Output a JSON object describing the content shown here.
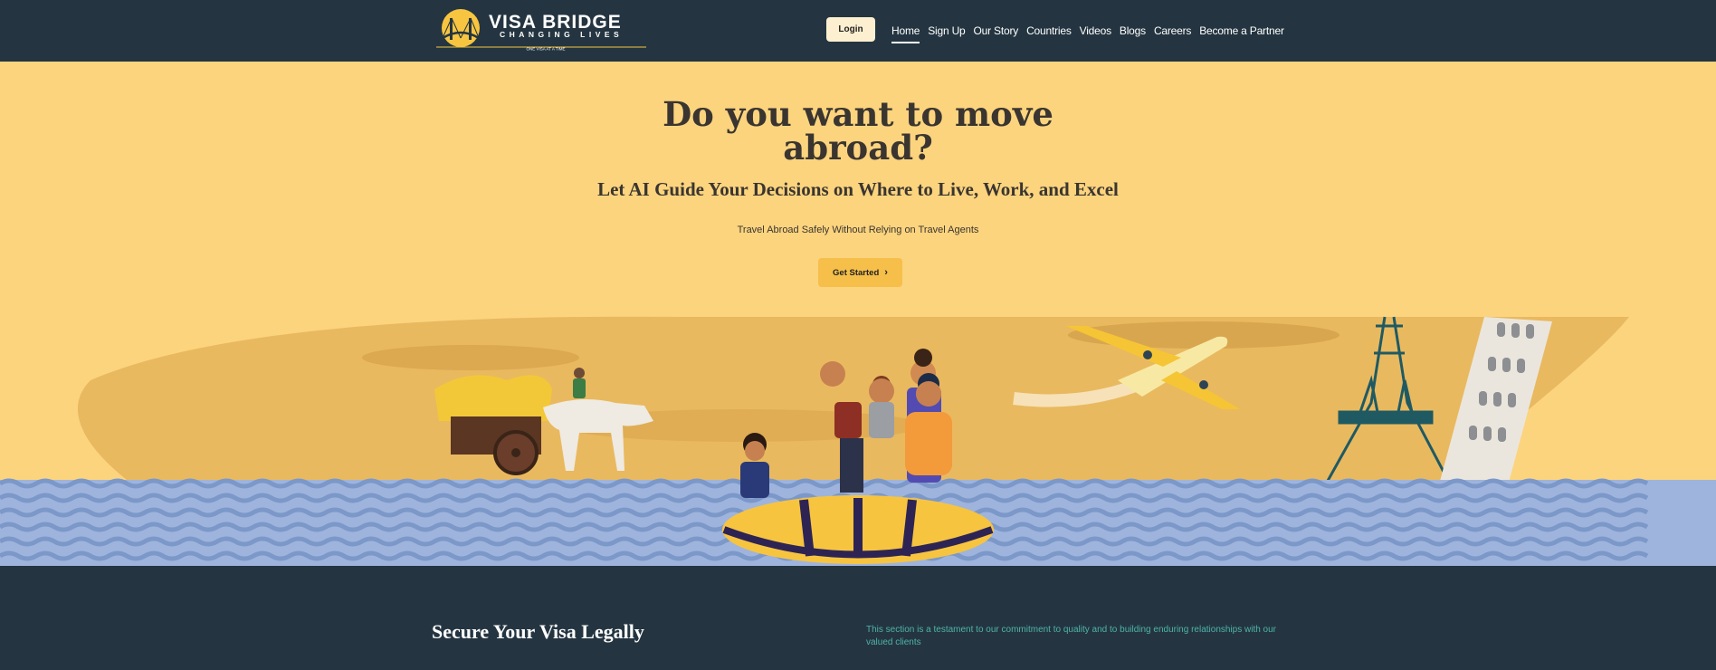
{
  "nav": {
    "logo": {
      "name": "VISA BRIDGE",
      "tagline": "CHANGING LIVES",
      "motto": "ONE VISA AT A TIME"
    },
    "login_label": "Login",
    "items": [
      {
        "label": "Home",
        "active": true
      },
      {
        "label": "Sign Up"
      },
      {
        "label": "Our Story"
      },
      {
        "label": "Countries"
      },
      {
        "label": "Videos"
      },
      {
        "label": "Blogs"
      },
      {
        "label": "Careers"
      },
      {
        "label": "Become a Partner"
      }
    ]
  },
  "hero": {
    "title": "Do you want to move abroad?",
    "subtitle": "Let AI Guide Your Decisions on Where to Live, Work, and Excel",
    "tagline": "Travel Abroad Safely Without Relying on Travel Agents",
    "cta_label": "Get Started",
    "cta_icon": "chevron-right-icon"
  },
  "section": {
    "title": "Secure Your Visa Legally",
    "text": "This section is a testament to our commitment to quality and to building enduring relationships with our valued clients"
  },
  "colors": {
    "nav_bg": "#243541",
    "hero_bg": "#fcd47e",
    "button_bg": "#f5bf4a",
    "wave_blue": "#7b98c9",
    "teal_text": "#4fb3a7"
  }
}
